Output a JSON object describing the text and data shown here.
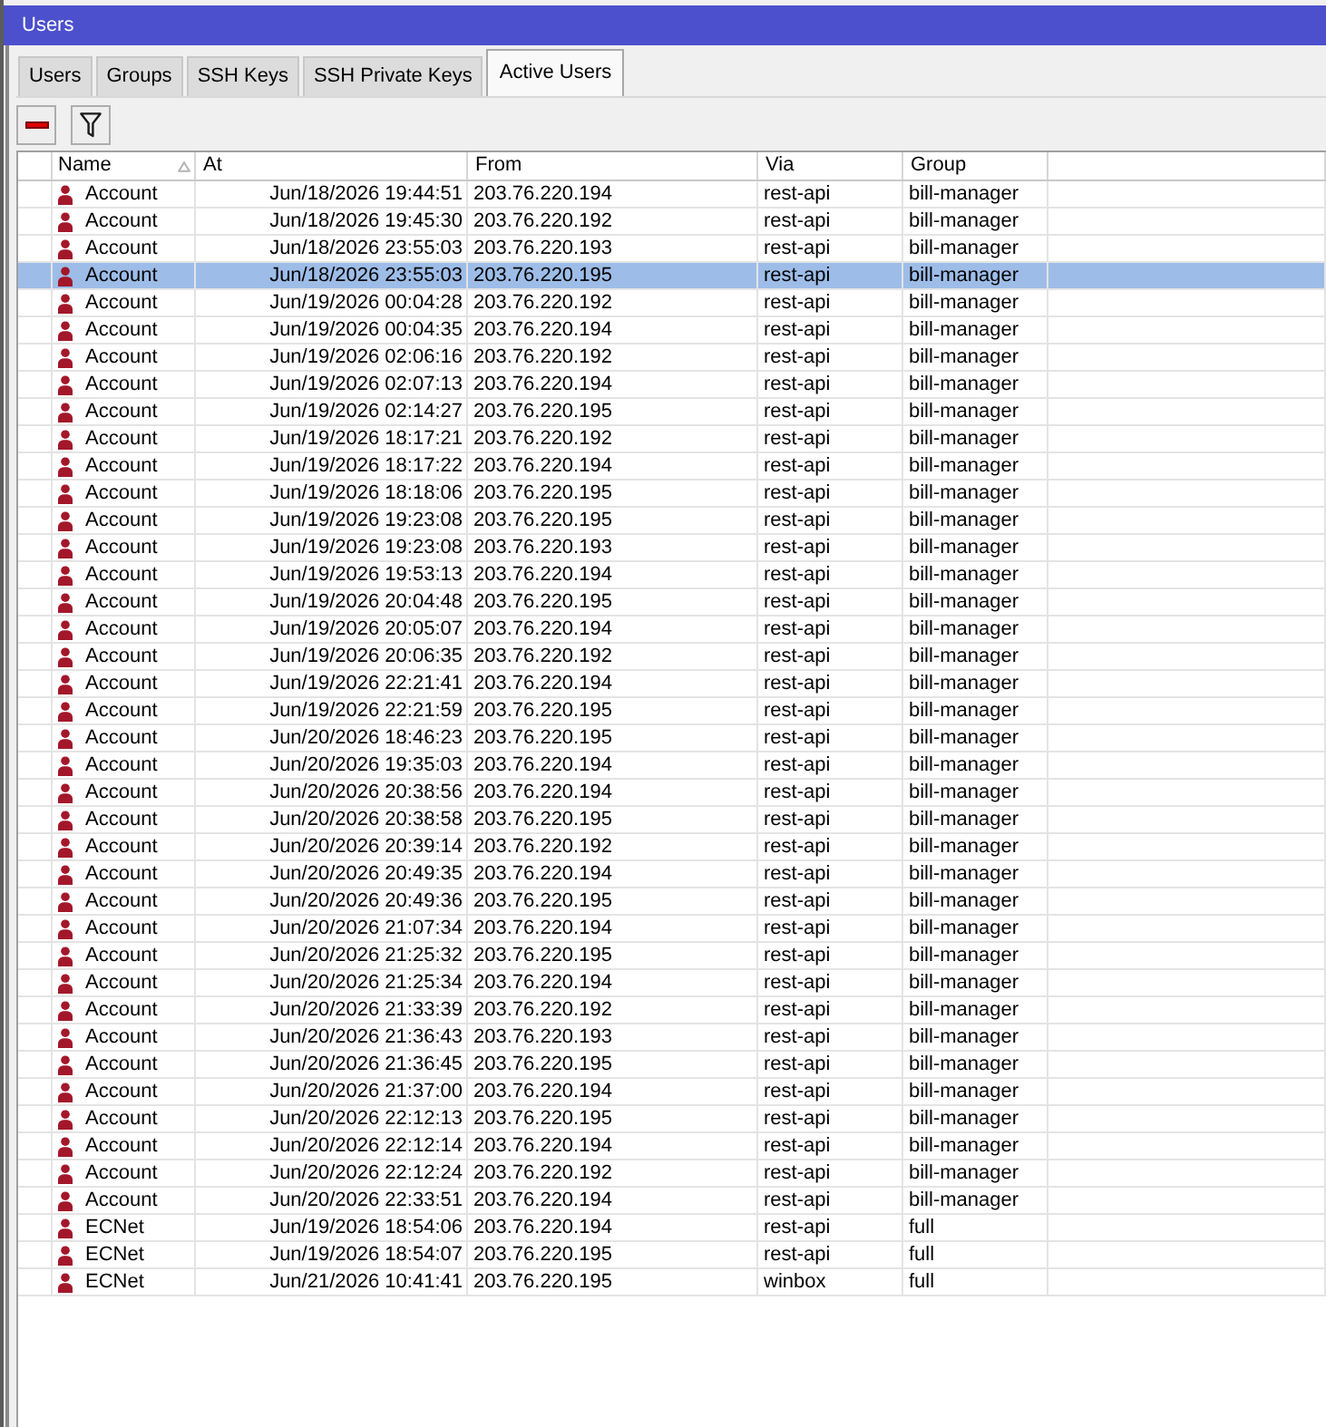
{
  "window": {
    "title": "Users"
  },
  "tabs": [
    {
      "label": "Users",
      "selected": false
    },
    {
      "label": "Groups",
      "selected": false
    },
    {
      "label": "SSH Keys",
      "selected": false
    },
    {
      "label": "SSH Private Keys",
      "selected": false
    },
    {
      "label": "Active Users",
      "selected": true
    }
  ],
  "table": {
    "columns": [
      {
        "label": "Name",
        "sorted": true
      },
      {
        "label": "At",
        "sorted": false
      },
      {
        "label": "From",
        "sorted": false
      },
      {
        "label": "Via",
        "sorted": false
      },
      {
        "label": "Group",
        "sorted": false
      }
    ],
    "rows": [
      {
        "name": "Account",
        "at": "Jun/18/2026 19:44:51",
        "from": "203.76.220.194",
        "via": "rest-api",
        "group": "bill-manager",
        "selected": false
      },
      {
        "name": "Account",
        "at": "Jun/18/2026 19:45:30",
        "from": "203.76.220.192",
        "via": "rest-api",
        "group": "bill-manager",
        "selected": false
      },
      {
        "name": "Account",
        "at": "Jun/18/2026 23:55:03",
        "from": "203.76.220.193",
        "via": "rest-api",
        "group": "bill-manager",
        "selected": false
      },
      {
        "name": "Account",
        "at": "Jun/18/2026 23:55:03",
        "from": "203.76.220.195",
        "via": "rest-api",
        "group": "bill-manager",
        "selected": true
      },
      {
        "name": "Account",
        "at": "Jun/19/2026 00:04:28",
        "from": "203.76.220.192",
        "via": "rest-api",
        "group": "bill-manager",
        "selected": false
      },
      {
        "name": "Account",
        "at": "Jun/19/2026 00:04:35",
        "from": "203.76.220.194",
        "via": "rest-api",
        "group": "bill-manager",
        "selected": false
      },
      {
        "name": "Account",
        "at": "Jun/19/2026 02:06:16",
        "from": "203.76.220.192",
        "via": "rest-api",
        "group": "bill-manager",
        "selected": false
      },
      {
        "name": "Account",
        "at": "Jun/19/2026 02:07:13",
        "from": "203.76.220.194",
        "via": "rest-api",
        "group": "bill-manager",
        "selected": false
      },
      {
        "name": "Account",
        "at": "Jun/19/2026 02:14:27",
        "from": "203.76.220.195",
        "via": "rest-api",
        "group": "bill-manager",
        "selected": false
      },
      {
        "name": "Account",
        "at": "Jun/19/2026 18:17:21",
        "from": "203.76.220.192",
        "via": "rest-api",
        "group": "bill-manager",
        "selected": false
      },
      {
        "name": "Account",
        "at": "Jun/19/2026 18:17:22",
        "from": "203.76.220.194",
        "via": "rest-api",
        "group": "bill-manager",
        "selected": false
      },
      {
        "name": "Account",
        "at": "Jun/19/2026 18:18:06",
        "from": "203.76.220.195",
        "via": "rest-api",
        "group": "bill-manager",
        "selected": false
      },
      {
        "name": "Account",
        "at": "Jun/19/2026 19:23:08",
        "from": "203.76.220.195",
        "via": "rest-api",
        "group": "bill-manager",
        "selected": false
      },
      {
        "name": "Account",
        "at": "Jun/19/2026 19:23:08",
        "from": "203.76.220.193",
        "via": "rest-api",
        "group": "bill-manager",
        "selected": false
      },
      {
        "name": "Account",
        "at": "Jun/19/2026 19:53:13",
        "from": "203.76.220.194",
        "via": "rest-api",
        "group": "bill-manager",
        "selected": false
      },
      {
        "name": "Account",
        "at": "Jun/19/2026 20:04:48",
        "from": "203.76.220.195",
        "via": "rest-api",
        "group": "bill-manager",
        "selected": false
      },
      {
        "name": "Account",
        "at": "Jun/19/2026 20:05:07",
        "from": "203.76.220.194",
        "via": "rest-api",
        "group": "bill-manager",
        "selected": false
      },
      {
        "name": "Account",
        "at": "Jun/19/2026 20:06:35",
        "from": "203.76.220.192",
        "via": "rest-api",
        "group": "bill-manager",
        "selected": false
      },
      {
        "name": "Account",
        "at": "Jun/19/2026 22:21:41",
        "from": "203.76.220.194",
        "via": "rest-api",
        "group": "bill-manager",
        "selected": false
      },
      {
        "name": "Account",
        "at": "Jun/19/2026 22:21:59",
        "from": "203.76.220.195",
        "via": "rest-api",
        "group": "bill-manager",
        "selected": false
      },
      {
        "name": "Account",
        "at": "Jun/20/2026 18:46:23",
        "from": "203.76.220.195",
        "via": "rest-api",
        "group": "bill-manager",
        "selected": false
      },
      {
        "name": "Account",
        "at": "Jun/20/2026 19:35:03",
        "from": "203.76.220.194",
        "via": "rest-api",
        "group": "bill-manager",
        "selected": false
      },
      {
        "name": "Account",
        "at": "Jun/20/2026 20:38:56",
        "from": "203.76.220.194",
        "via": "rest-api",
        "group": "bill-manager",
        "selected": false
      },
      {
        "name": "Account",
        "at": "Jun/20/2026 20:38:58",
        "from": "203.76.220.195",
        "via": "rest-api",
        "group": "bill-manager",
        "selected": false
      },
      {
        "name": "Account",
        "at": "Jun/20/2026 20:39:14",
        "from": "203.76.220.192",
        "via": "rest-api",
        "group": "bill-manager",
        "selected": false
      },
      {
        "name": "Account",
        "at": "Jun/20/2026 20:49:35",
        "from": "203.76.220.194",
        "via": "rest-api",
        "group": "bill-manager",
        "selected": false
      },
      {
        "name": "Account",
        "at": "Jun/20/2026 20:49:36",
        "from": "203.76.220.195",
        "via": "rest-api",
        "group": "bill-manager",
        "selected": false
      },
      {
        "name": "Account",
        "at": "Jun/20/2026 21:07:34",
        "from": "203.76.220.194",
        "via": "rest-api",
        "group": "bill-manager",
        "selected": false
      },
      {
        "name": "Account",
        "at": "Jun/20/2026 21:25:32",
        "from": "203.76.220.195",
        "via": "rest-api",
        "group": "bill-manager",
        "selected": false
      },
      {
        "name": "Account",
        "at": "Jun/20/2026 21:25:34",
        "from": "203.76.220.194",
        "via": "rest-api",
        "group": "bill-manager",
        "selected": false
      },
      {
        "name": "Account",
        "at": "Jun/20/2026 21:33:39",
        "from": "203.76.220.192",
        "via": "rest-api",
        "group": "bill-manager",
        "selected": false
      },
      {
        "name": "Account",
        "at": "Jun/20/2026 21:36:43",
        "from": "203.76.220.193",
        "via": "rest-api",
        "group": "bill-manager",
        "selected": false
      },
      {
        "name": "Account",
        "at": "Jun/20/2026 21:36:45",
        "from": "203.76.220.195",
        "via": "rest-api",
        "group": "bill-manager",
        "selected": false
      },
      {
        "name": "Account",
        "at": "Jun/20/2026 21:37:00",
        "from": "203.76.220.194",
        "via": "rest-api",
        "group": "bill-manager",
        "selected": false
      },
      {
        "name": "Account",
        "at": "Jun/20/2026 22:12:13",
        "from": "203.76.220.195",
        "via": "rest-api",
        "group": "bill-manager",
        "selected": false
      },
      {
        "name": "Account",
        "at": "Jun/20/2026 22:12:14",
        "from": "203.76.220.194",
        "via": "rest-api",
        "group": "bill-manager",
        "selected": false
      },
      {
        "name": "Account",
        "at": "Jun/20/2026 22:12:24",
        "from": "203.76.220.192",
        "via": "rest-api",
        "group": "bill-manager",
        "selected": false
      },
      {
        "name": "Account",
        "at": "Jun/20/2026 22:33:51",
        "from": "203.76.220.194",
        "via": "rest-api",
        "group": "bill-manager",
        "selected": false
      },
      {
        "name": "ECNet",
        "at": "Jun/19/2026 18:54:06",
        "from": "203.76.220.194",
        "via": "rest-api",
        "group": "full",
        "selected": false
      },
      {
        "name": "ECNet",
        "at": "Jun/19/2026 18:54:07",
        "from": "203.76.220.195",
        "via": "rest-api",
        "group": "full",
        "selected": false
      },
      {
        "name": "ECNet",
        "at": "Jun/21/2026 10:41:41",
        "from": "203.76.220.195",
        "via": "winbox",
        "group": "full",
        "selected": false
      }
    ]
  }
}
